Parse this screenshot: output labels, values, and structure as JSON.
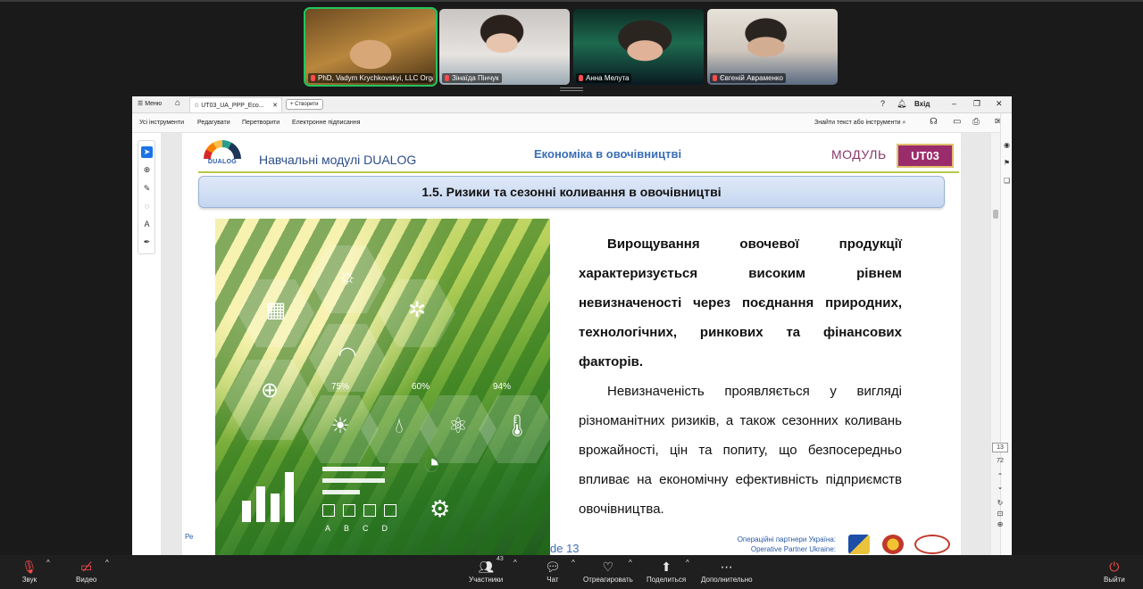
{
  "participants": [
    {
      "name": "PhD, Vadym Krychkovskyi, LLC Orga...",
      "active": true
    },
    {
      "name": "Зінаїда Пінчук",
      "active": false
    },
    {
      "name": "Анна Мелута",
      "active": false
    },
    {
      "name": "Євгеній Авраменко",
      "active": false
    }
  ],
  "pdf": {
    "menu_label": "Меню",
    "tab_title": "UT03_UA_PPP_Eco...",
    "create_label": "Створити",
    "signin_label": "Вхід",
    "toolbar": {
      "all_tools": "Усі інструменти",
      "edit": "Редагувати",
      "convert": "Перетворити",
      "e_sign": "Електронне підписання",
      "find": "Знайти текст або інструменти"
    },
    "page_nav": {
      "current": "13",
      "total": "72"
    }
  },
  "slide": {
    "logo_text": "DUALOG",
    "modules_label": "Навчальні модулі  DUALOG",
    "course_title": "Економіка в овочівництві",
    "module_label": "МОДУЛЬ",
    "module_code": "UT03",
    "section_title": "1.5. Ризики та сезонні коливання в овочівництві",
    "photo_percents": [
      "75%",
      "60%",
      "94%"
    ],
    "photo_letters": [
      "A",
      "B",
      "C",
      "D"
    ],
    "paragraph_1": "Вирощування овочевої продукції характеризується високим рівнем невизначеності через поєднання природних, технологічних, ринкових та фінансових факторів.",
    "paragraph_2": "Невизначеність проявляється у вигляді різноманітних ризиків, а також сезонних коливань врожайності, цін та попиту, що безпосередньо впливає на економічну ефективність підприємств овочівництва.",
    "footer_left": "Ре",
    "footer_page": "de 13",
    "partners_line1": "Операційні партнери Україна:",
    "partners_line2": "Operative Partner Ukraine:"
  },
  "meeting_bar": {
    "audio": "Звук",
    "video": "Видео",
    "participants": "Участники",
    "participants_count": "43",
    "chat": "Чат",
    "react": "Отреагировать",
    "share": "Поделиться",
    "more": "Дополнительно",
    "leave": "Выйти"
  },
  "colors": {
    "active_speaker": "#22c55e",
    "muted": "#ff4b4b",
    "module_badge": "#9b2c6b",
    "title_bar": "#c5d6f0",
    "header_rule": "#b6c94a"
  }
}
